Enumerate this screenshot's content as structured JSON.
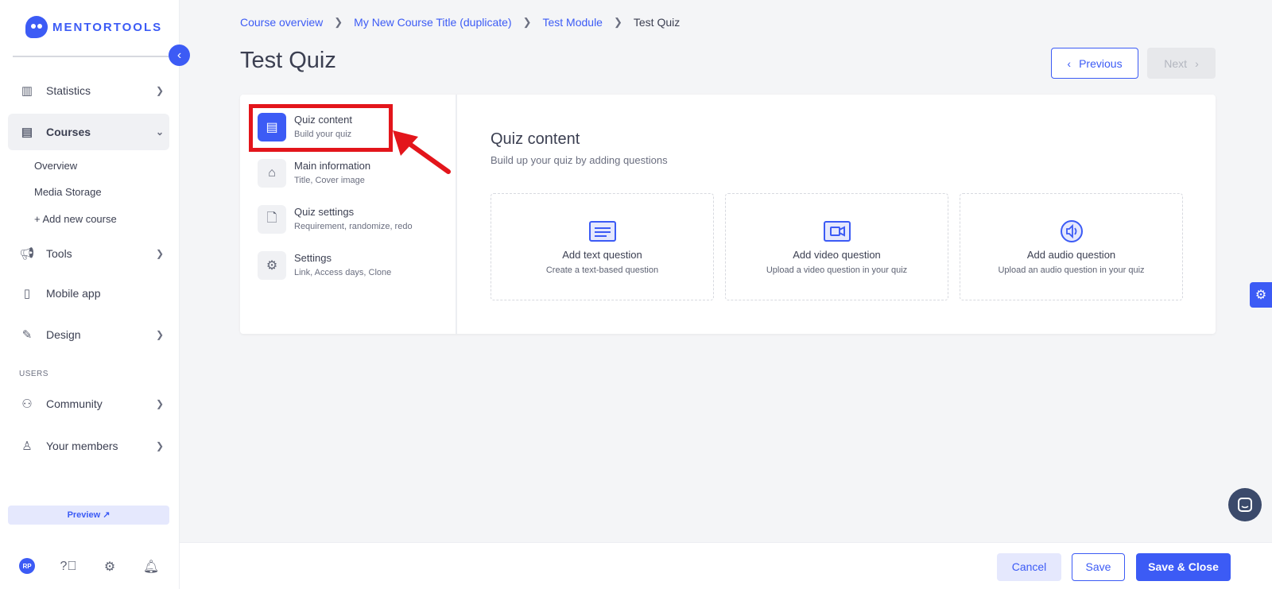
{
  "app": {
    "logo_text": "MENTORTOOLS"
  },
  "sidebar": {
    "items": [
      {
        "label": "Statistics",
        "icon": "bar-chart-icon"
      },
      {
        "label": "Courses",
        "icon": "book-icon"
      },
      {
        "label": "Tools",
        "icon": "megaphone-icon"
      },
      {
        "label": "Mobile app",
        "icon": "mobile-icon"
      },
      {
        "label": "Design",
        "icon": "pencil-icon"
      },
      {
        "label": "Community",
        "icon": "group-icon"
      },
      {
        "label": "Your members",
        "icon": "user-icon"
      }
    ],
    "sub_items": [
      "Overview",
      "Media Storage",
      "+ Add new course"
    ],
    "section_users": "USERS",
    "preview": "Preview ↗",
    "avatar_initials": "RP"
  },
  "breadcrumb": {
    "items": [
      "Course overview",
      "My New Course Title (duplicate)",
      "Test Module"
    ],
    "current": "Test Quiz"
  },
  "page": {
    "title": "Test Quiz",
    "prev": "Previous",
    "next": "Next"
  },
  "quiz_menu": [
    {
      "title": "Quiz content",
      "sub": "Build your quiz",
      "icon": "book-icon",
      "active": true
    },
    {
      "title": "Main information",
      "sub": "Title, Cover image",
      "icon": "home-icon"
    },
    {
      "title": "Quiz settings",
      "sub": "Requirement, randomize, redo",
      "icon": "document-icon"
    },
    {
      "title": "Settings",
      "sub": "Link, Access days, Clone",
      "icon": "gear-icon"
    }
  ],
  "content": {
    "title": "Quiz content",
    "subtitle": "Build up your quiz by adding questions",
    "cards": [
      {
        "title": "Add text question",
        "sub": "Create a text-based question",
        "icon": "text-icon"
      },
      {
        "title": "Add video question",
        "sub": "Upload a video question in your quiz",
        "icon": "video-icon"
      },
      {
        "title": "Add audio question",
        "sub": "Upload an audio question in your quiz",
        "icon": "audio-icon"
      }
    ]
  },
  "footer": {
    "cancel": "Cancel",
    "save": "Save",
    "save_close": "Save & Close"
  },
  "colors": {
    "accent": "#3c5bf5",
    "highlight": "#e3151b"
  }
}
